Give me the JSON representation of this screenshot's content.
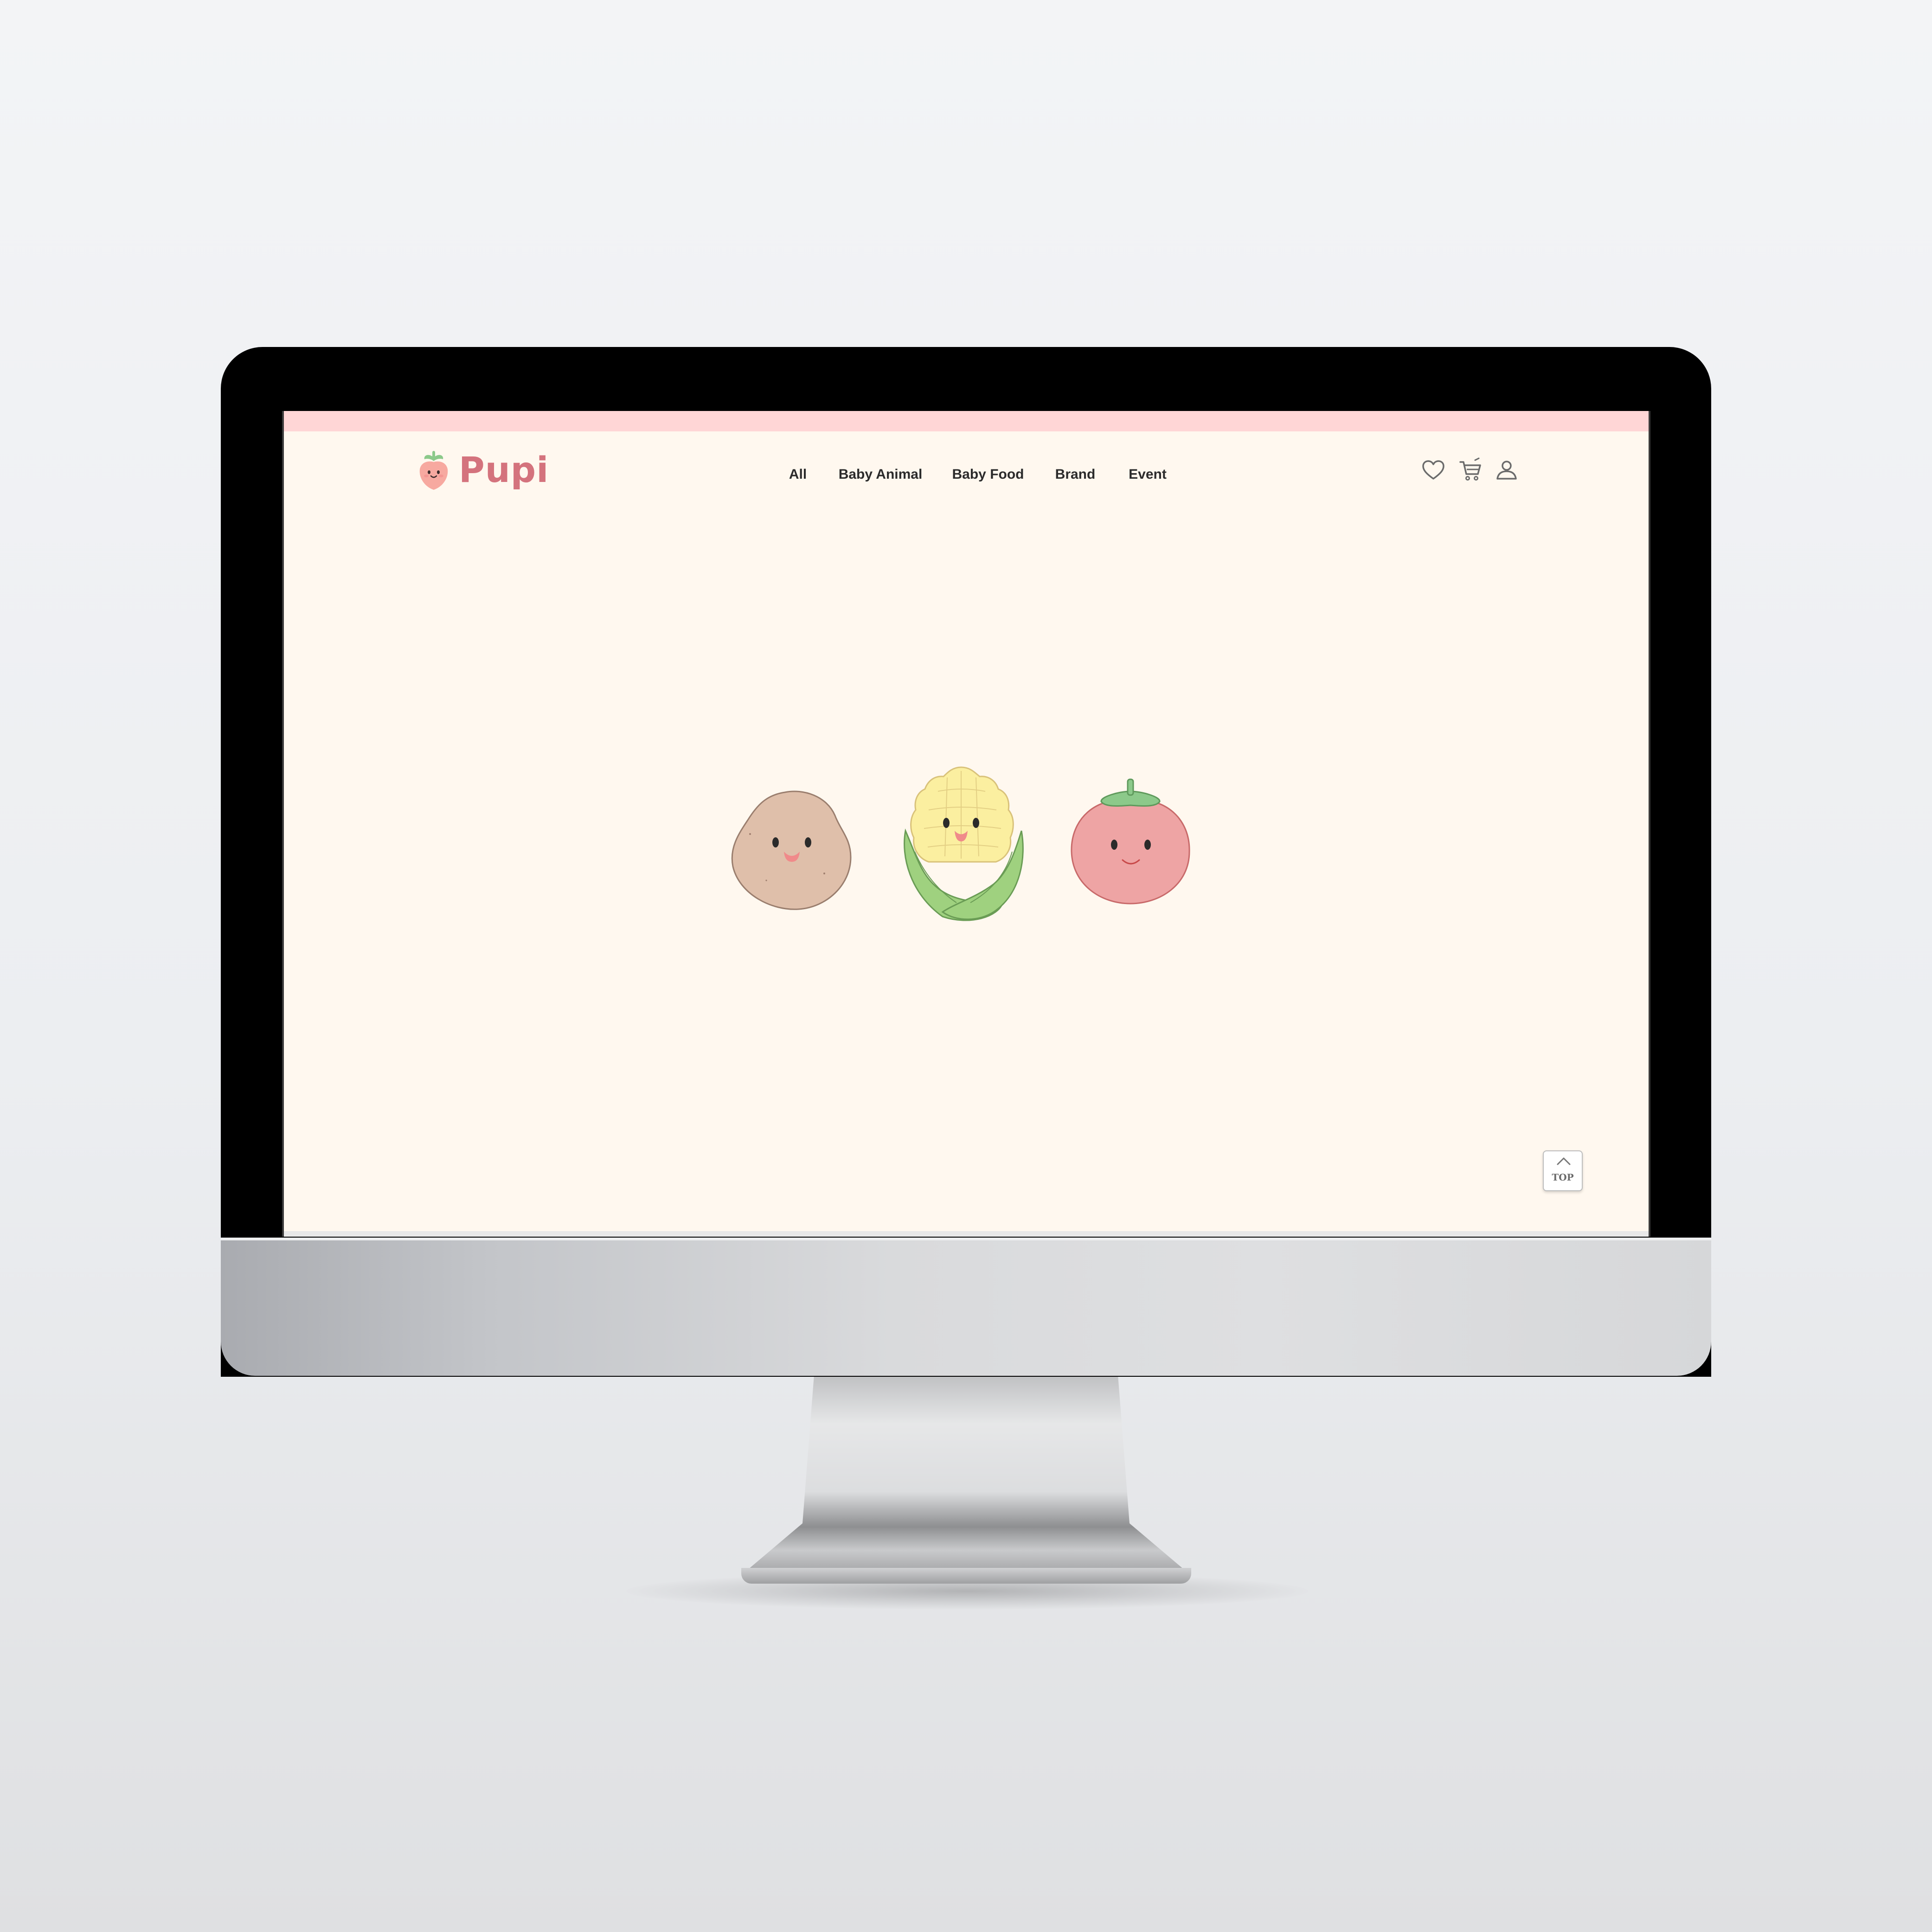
{
  "brand": {
    "name": "Pupi",
    "color": "#d4737d",
    "background": "#fff8ef",
    "top_strip_color": "#ffd6d6"
  },
  "nav": {
    "items": [
      {
        "label": "All"
      },
      {
        "label": "Baby Animal"
      },
      {
        "label": "Baby Food"
      },
      {
        "label": "Brand"
      },
      {
        "label": "Event"
      }
    ]
  },
  "header_icons": [
    "heart-icon",
    "cart-icon",
    "user-icon"
  ],
  "hero": {
    "characters": [
      "potato-character",
      "corn-character",
      "tomato-character"
    ]
  },
  "scroll_top": {
    "label": "TOP"
  }
}
